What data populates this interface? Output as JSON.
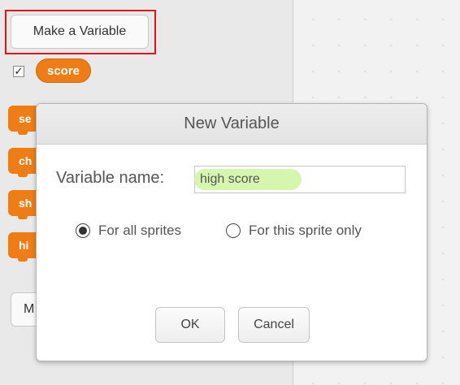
{
  "palette": {
    "make_variable_label": "Make a Variable",
    "checkbox_mark": "✓",
    "variable_reporter": "score",
    "partial_blocks": [
      "se",
      "ch",
      "sh",
      "hi"
    ],
    "make_list_partial": "M"
  },
  "dialog": {
    "title": "New Variable",
    "variable_name_label": "Variable name:",
    "variable_name_value": "high score",
    "radio_options": [
      {
        "label": "For all sprites",
        "selected": true
      },
      {
        "label": "For this sprite only",
        "selected": false
      }
    ],
    "ok_label": "OK",
    "cancel_label": "Cancel"
  },
  "colors": {
    "variable_orange": "#ee7d16",
    "highlight_red": "#e0151c",
    "text_highlight_green": "#cff5a2"
  }
}
